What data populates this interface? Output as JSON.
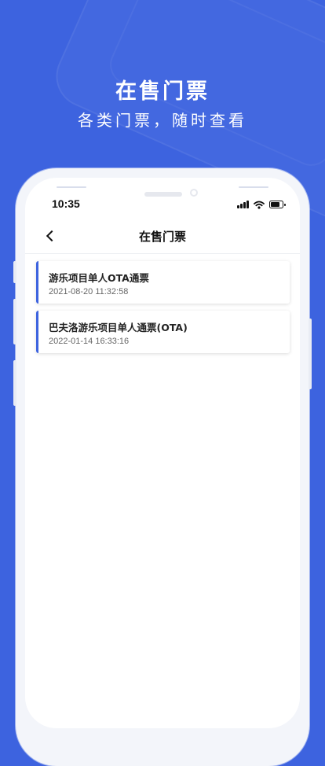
{
  "hero": {
    "title": "在售门票",
    "subtitle": "各类门票，随时查看"
  },
  "status_bar": {
    "time": "10:35",
    "icons": [
      "signal-icon",
      "wifi-icon",
      "battery-icon"
    ]
  },
  "nav": {
    "title": "在售门票",
    "back_icon": "chevron-left-icon"
  },
  "tickets": [
    {
      "name": "游乐项目单人OTA通票",
      "time": "2021-08-20 11:32:58"
    },
    {
      "name": "巴夫洛游乐项目单人通票(OTA)",
      "time": "2022-01-14 16:33:16"
    }
  ],
  "colors": {
    "background": "#3d63df",
    "accent": "#3d63df"
  }
}
